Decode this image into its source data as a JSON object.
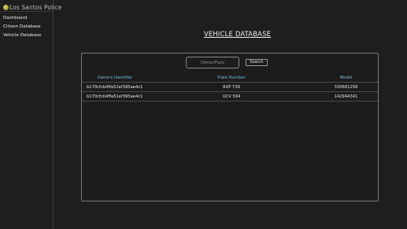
{
  "app": {
    "brand": "Los Santos Police"
  },
  "sidebar": {
    "items": [
      {
        "label": "Dashboard"
      },
      {
        "label": "Citizen Database"
      },
      {
        "label": "Vehicle Database"
      }
    ]
  },
  "main": {
    "title": "VEHICLE DATABASE",
    "search": {
      "placeholder": "Owner/Plate",
      "value": "",
      "button_label": "Search"
    },
    "table": {
      "headers": [
        "Owners Identifier",
        "Plate Number",
        "Model"
      ],
      "rows": [
        [
          "b170cfcb4ffa51ef395ae4c1",
          "RXP 739",
          "330661258"
        ],
        [
          "b170cfcb4ffa51ef395ae4c1",
          "UCV 594",
          "142944341"
        ]
      ]
    }
  },
  "colors": {
    "background": "#1e1e1e",
    "header_text": "#79b6d8",
    "border": "#7a7a7a"
  }
}
